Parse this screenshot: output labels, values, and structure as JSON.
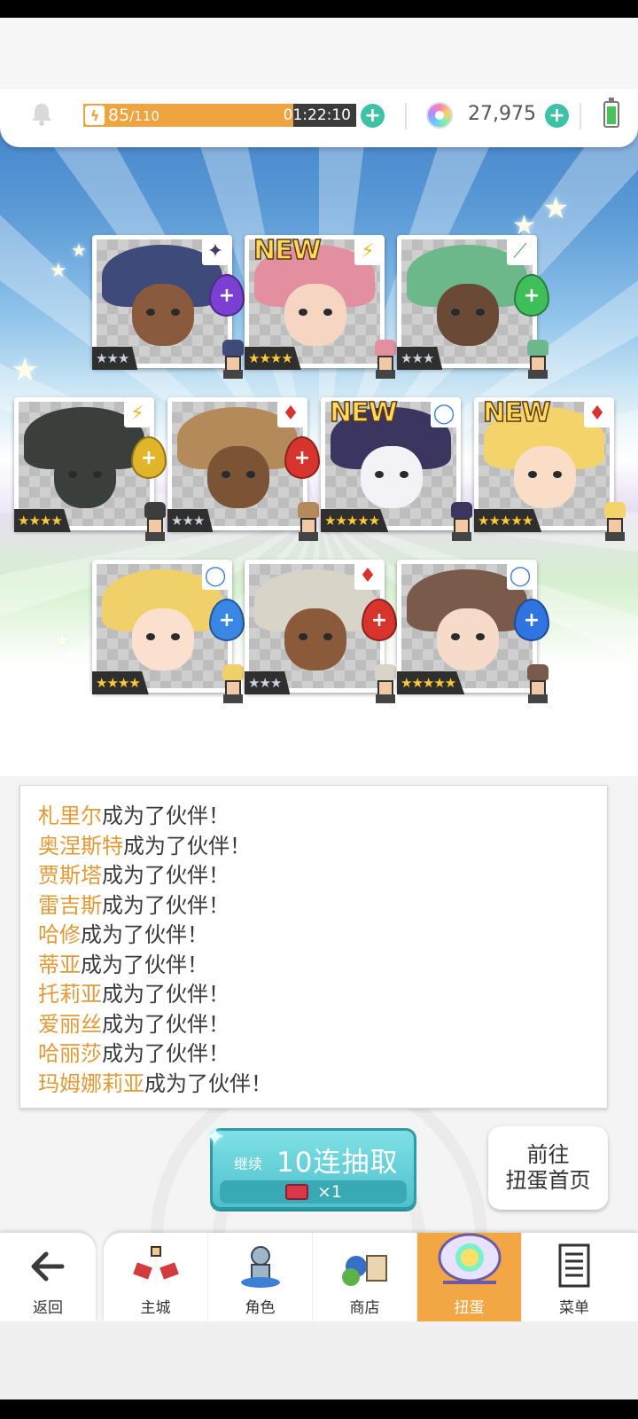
{
  "status_bar": {
    "stamina_current": "85",
    "stamina_max": "/110",
    "stamina_fraction": 0.77,
    "timer": "01:22:10",
    "gems": "27,975",
    "plus_symbol": "+"
  },
  "cards": [
    {
      "stars": "★★★",
      "rarity": 3,
      "element": "dark",
      "element_glyph": "✦",
      "new": false,
      "orb_glyph": "+"
    },
    {
      "stars": "★★★★",
      "rarity": 4,
      "element": "thunder",
      "element_glyph": "⚡",
      "new": true,
      "orb_glyph": ""
    },
    {
      "stars": "★★★",
      "rarity": 3,
      "element": "wind",
      "element_glyph": "⟋",
      "new": false,
      "orb_glyph": "+"
    },
    {
      "stars": "★★★★",
      "rarity": 4,
      "element": "thunder",
      "element_glyph": "⚡",
      "new": false,
      "orb_glyph": "+"
    },
    {
      "stars": "★★★",
      "rarity": 3,
      "element": "fire",
      "element_glyph": "♦",
      "new": false,
      "orb_glyph": "+"
    },
    {
      "stars": "★★★★★",
      "rarity": 5,
      "element": "water",
      "element_glyph": "◯",
      "new": true,
      "orb_glyph": ""
    },
    {
      "stars": "★★★★★",
      "rarity": 5,
      "element": "fire",
      "element_glyph": "♦",
      "new": true,
      "orb_glyph": ""
    },
    {
      "stars": "★★★★",
      "rarity": 4,
      "element": "water",
      "element_glyph": "◯",
      "new": false,
      "orb_glyph": "+"
    },
    {
      "stars": "★★★",
      "rarity": 3,
      "element": "fire",
      "element_glyph": "♦",
      "new": false,
      "orb_glyph": "+"
    },
    {
      "stars": "★★★★★",
      "rarity": 5,
      "element": "water",
      "element_glyph": "◯",
      "new": false,
      "orb_glyph": "+"
    }
  ],
  "new_label": "NEW",
  "log": [
    {
      "name": "札里尔",
      "suffix": "成为了伙伴！"
    },
    {
      "name": "奥涅斯特",
      "suffix": "成为了伙伴！"
    },
    {
      "name": "贾斯塔",
      "suffix": "成为了伙伴！"
    },
    {
      "name": "雷吉斯",
      "suffix": "成为了伙伴！"
    },
    {
      "name": "哈修",
      "suffix": "成为了伙伴！"
    },
    {
      "name": "蒂亚",
      "suffix": "成为了伙伴！"
    },
    {
      "name": "托莉亚",
      "suffix": "成为了伙伴！"
    },
    {
      "name": "爱丽丝",
      "suffix": "成为了伙伴！"
    },
    {
      "name": "哈丽莎",
      "suffix": "成为了伙伴！"
    },
    {
      "name": "玛姆娜莉亚",
      "suffix": "成为了伙伴！"
    }
  ],
  "continue_button": {
    "small": "继续",
    "big": "10连抽取",
    "ticket_count": "×1"
  },
  "gacha_home_button": {
    "line1": "前往",
    "line2": "扭蛋首页"
  },
  "nav": {
    "back": "返回",
    "tabs": [
      "主城",
      "角色",
      "商店",
      "扭蛋",
      "菜单"
    ],
    "active_index": 3
  },
  "colors": {
    "accent": "#f2a644",
    "name_highlight": "#e49a34",
    "teal": "#3fc1a8"
  }
}
